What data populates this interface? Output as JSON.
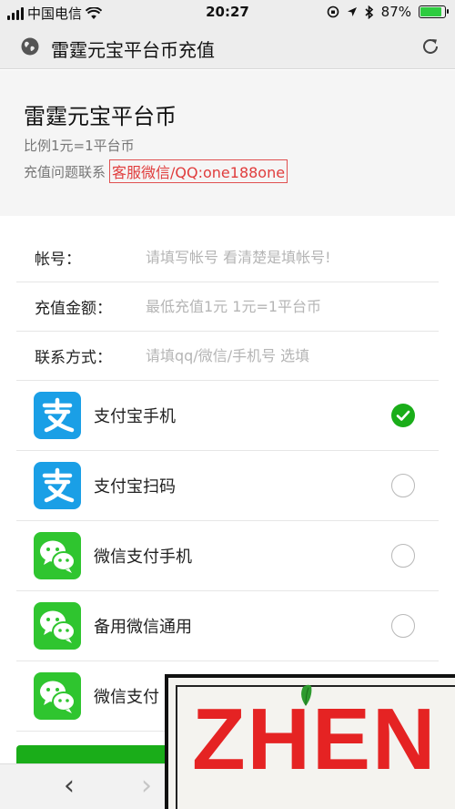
{
  "status_bar": {
    "carrier": "中国电信",
    "time": "20:27",
    "battery_percent": "87%",
    "battery_level": 0.87
  },
  "nav": {
    "title": "雷霆元宝平台币充值"
  },
  "header": {
    "title": "雷霆元宝平台币",
    "ratio": "比例1元=1平台币",
    "contact_label": "充值问题联系",
    "contact_value": "客服微信/QQ:one188one"
  },
  "form": {
    "account": {
      "label": "帐号：",
      "placeholder": "请填写帐号 看清楚是填帐号!"
    },
    "amount": {
      "label": "充值金额：",
      "placeholder": "最低充值1元 1元=1平台币"
    },
    "contact": {
      "label": "联系方式：",
      "placeholder": "请填qq/微信/手机号 选填"
    }
  },
  "payments": [
    {
      "label": "支付宝手机",
      "icon": "alipay-icon",
      "selected": true
    },
    {
      "label": "支付宝扫码",
      "icon": "alipay-icon",
      "selected": false
    },
    {
      "label": "微信支付手机",
      "icon": "wechat-icon",
      "selected": false
    },
    {
      "label": "备用微信通用",
      "icon": "wechat-icon",
      "selected": false
    },
    {
      "label": "微信支付",
      "icon": "wechat-icon",
      "selected": false
    }
  ],
  "bottom_nav": {
    "back": "‹",
    "forward": "›"
  },
  "watermark": {
    "text": "ZHEN"
  },
  "colors": {
    "accent_green": "#1aad19",
    "alipay_blue": "#1a9fe6",
    "wechat_green": "#2fc52f",
    "contact_red": "#e03c3c",
    "watermark_red": "#e52323"
  }
}
